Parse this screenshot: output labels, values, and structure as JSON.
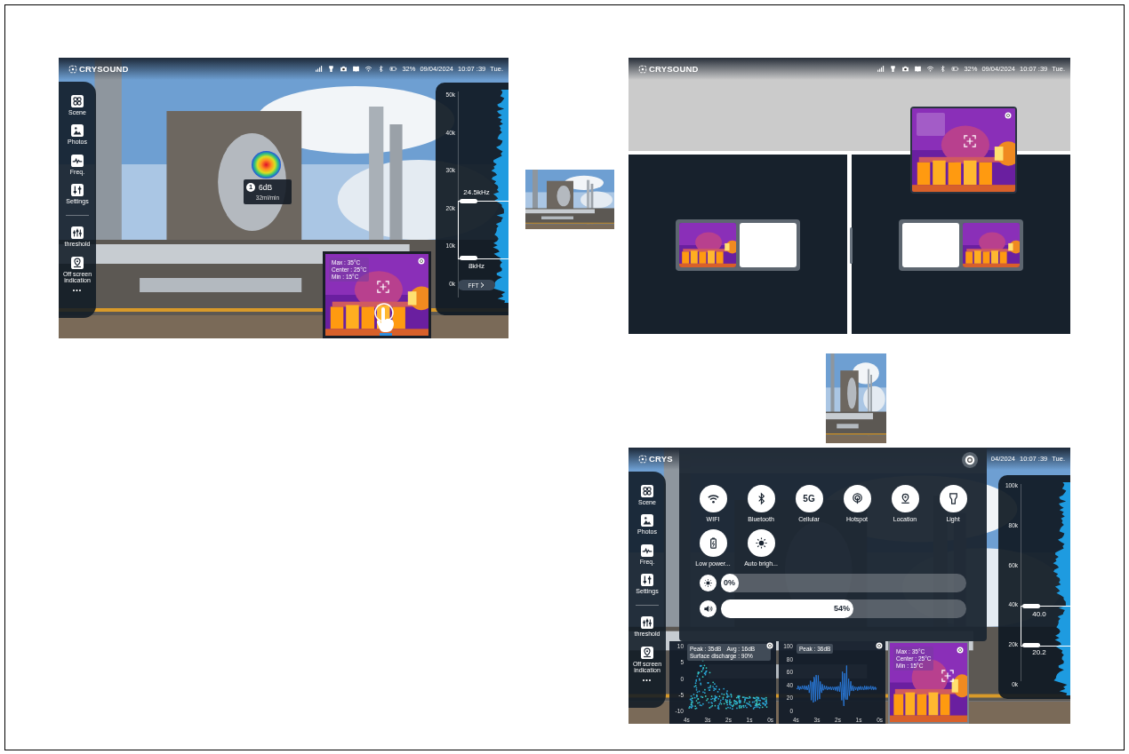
{
  "screens": [
    {
      "kind": "live",
      "status": {
        "logo": "CRYSOUND",
        "battery": "32%",
        "date": "09/04/2024",
        "time": "10:07 :39",
        "day": "Tue."
      },
      "sidebar": {
        "items": [
          "Scene",
          "Photos",
          "Freq.",
          "Settings",
          "threshold",
          "Off screen indication"
        ],
        "more": "•••"
      },
      "marker": {
        "badge": "1",
        "level": "6dB",
        "rate": "32ml/min"
      },
      "spectrum": {
        "ticks": [
          "50k",
          "40k",
          "30k",
          "20k",
          "10k",
          "0k"
        ],
        "upper": "24.5kHz",
        "lower": "8kHz",
        "button": "FFT"
      },
      "thermal": {
        "readings": [
          "Max : 35°C",
          "Center : 25°C",
          "Min : 15°C"
        ]
      }
    },
    {
      "kind": "split",
      "status": {
        "logo": "CRYSOUND",
        "battery": "32%",
        "date": "09/04/2024",
        "time": "10:07 :39",
        "day": "Tue."
      }
    },
    {
      "kind": "control_center",
      "status": {
        "logo": "CRYS",
        "date": "04/2024",
        "time": "10:07 :39",
        "day": "Tue."
      },
      "sidebar": {
        "items": [
          "Scene",
          "Photos",
          "Freq.",
          "Settings",
          "threshold",
          "Off screen indication"
        ],
        "more": "•••"
      },
      "toggles": [
        {
          "label": "WIFI"
        },
        {
          "label": "Bluetooth"
        },
        {
          "label": "Cellular",
          "glyph": "5G"
        },
        {
          "label": "Hotspot"
        },
        {
          "label": "Location"
        },
        {
          "label": "Light"
        },
        {
          "label": "Low power..."
        },
        {
          "label": "Auto brigh..."
        }
      ],
      "sliders": [
        {
          "reading": "0%",
          "level": 0
        },
        {
          "reading": "54%",
          "level": 0.54
        }
      ],
      "spectrum": {
        "ticks": [
          "100k",
          "80k",
          "60k",
          "40k",
          "20k",
          "0k"
        ],
        "upper": "40.0",
        "lower": "20.2"
      },
      "charts": [
        {
          "kind": "scatter",
          "tags": [
            "Peak : 35dB",
            "Avg : 16dB",
            "Surface discharge : 90%"
          ],
          "y_ticks": [
            "10",
            "5",
            "0",
            "-5",
            "-10"
          ],
          "x_ticks": [
            "4s",
            "3s",
            "2s",
            "1s",
            "0s"
          ]
        },
        {
          "kind": "waveform",
          "tags": [
            "Peak : 36dB"
          ],
          "y_ticks": [
            "100",
            "80",
            "60",
            "40",
            "20",
            "0"
          ],
          "x_ticks": [
            "4s",
            "3s",
            "2s",
            "1s",
            "0s"
          ]
        }
      ],
      "thermal": {
        "readings": [
          "Max : 35°C",
          "Center : 25°C",
          "Min : 15°C"
        ]
      }
    }
  ]
}
